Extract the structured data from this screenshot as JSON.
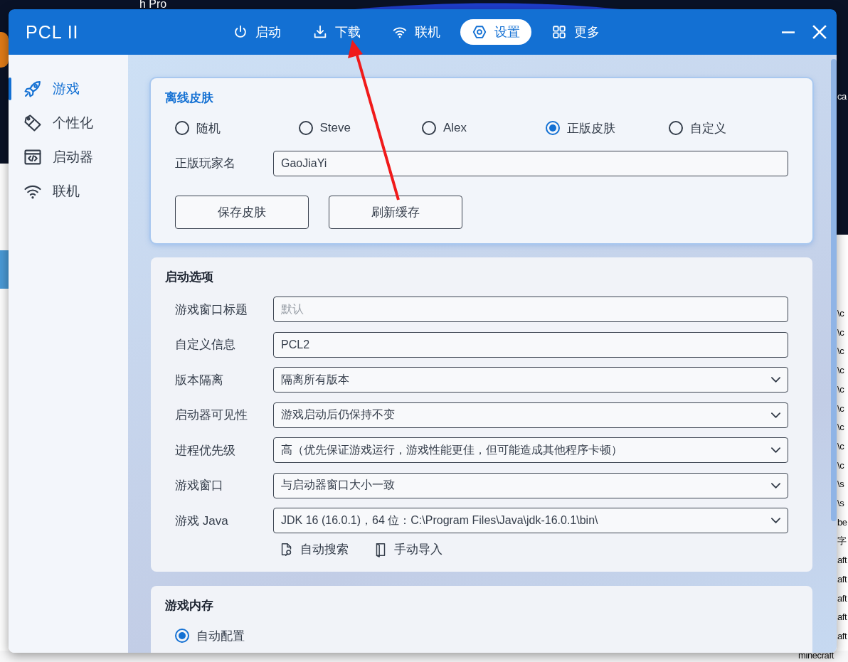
{
  "desktop": {
    "caption": "h Pro",
    "side_top": "ca",
    "side_lines": [
      "\\c",
      "\\c",
      "\\c",
      "\\c",
      "\\c",
      "\\c",
      "\\c",
      "\\c",
      "\\c",
      "\\s",
      "\\s",
      "be",
      "字",
      "aft",
      "aft",
      "aft",
      "aft",
      "aft",
      "minecraft"
    ]
  },
  "window": {
    "title": "PCL II"
  },
  "nav": [
    {
      "label": "启动",
      "selected": false
    },
    {
      "label": "下载",
      "selected": false
    },
    {
      "label": "联机",
      "selected": false
    },
    {
      "label": "设置",
      "selected": true
    },
    {
      "label": "更多",
      "selected": false
    }
  ],
  "sidebar": {
    "items": [
      {
        "label": "游戏",
        "selected": true
      },
      {
        "label": "个性化",
        "selected": false
      },
      {
        "label": "启动器",
        "selected": false
      },
      {
        "label": "联机",
        "selected": false
      }
    ]
  },
  "skin_card": {
    "title": "离线皮肤",
    "highlighted": true,
    "options": [
      {
        "label": "随机",
        "selected": false
      },
      {
        "label": "Steve",
        "selected": false
      },
      {
        "label": "Alex",
        "selected": false
      },
      {
        "label": "正版皮肤",
        "selected": true
      },
      {
        "label": "自定义",
        "selected": false
      }
    ],
    "field": {
      "label": "正版玩家名",
      "value": "GaoJiaYi"
    },
    "buttons": [
      "保存皮肤",
      "刷新缓存"
    ]
  },
  "launch_card": {
    "title": "启动选项",
    "highlighted": false,
    "rows": [
      {
        "label": "游戏窗口标题",
        "kind": "text",
        "placeholder": "默认"
      },
      {
        "label": "自定义信息",
        "kind": "text",
        "value": "PCL2"
      },
      {
        "label": "版本隔离",
        "kind": "select",
        "value": "隔离所有版本"
      },
      {
        "label": "启动器可见性",
        "kind": "select",
        "value": "游戏启动后仍保持不变"
      },
      {
        "label": "进程优先级",
        "kind": "select",
        "value": "高（优先保证游戏运行，游戏性能更佳，但可能造成其他程序卡顿）"
      },
      {
        "label": "游戏窗口",
        "kind": "select",
        "value": "与启动器窗口大小一致"
      },
      {
        "label": "游戏 Java",
        "kind": "select",
        "value": "JDK 16 (16.0.1)，64 位：C:\\Program Files\\Java\\jdk-16.0.1\\bin\\"
      }
    ],
    "links": [
      {
        "label": "自动搜索"
      },
      {
        "label": "手动导入"
      }
    ]
  },
  "memory_card": {
    "title": "游戏内存",
    "highlighted": false,
    "options": [
      {
        "label": "自动配置",
        "selected": true
      }
    ]
  }
}
